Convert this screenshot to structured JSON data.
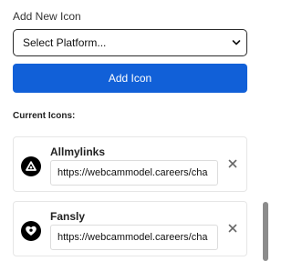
{
  "add_section": {
    "label": "Add New Icon",
    "select_value": "Select Platform...",
    "add_button_label": "Add Icon"
  },
  "current_section": {
    "label": "Current Icons:",
    "icons": [
      {
        "name": "Allmylinks",
        "url": "https://webcammodel.careers/cha",
        "icon": "allmylinks-logo-icon"
      },
      {
        "name": "Fansly",
        "url": "https://webcammodel.careers/cha",
        "icon": "fansly-logo-icon"
      }
    ]
  },
  "colors": {
    "accent": "#1160d8",
    "logo_bg": "#000000",
    "border": "#e6e6e6"
  }
}
